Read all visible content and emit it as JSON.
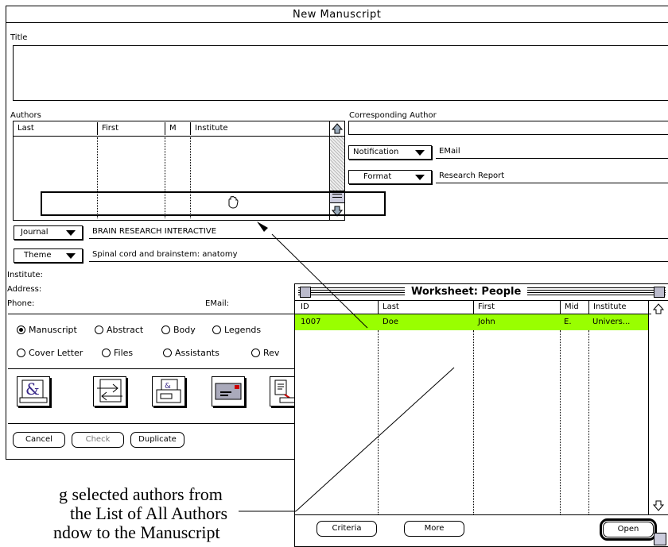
{
  "window": {
    "title": "New Manuscript"
  },
  "title_section": {
    "label": "Title",
    "value": ""
  },
  "authors": {
    "label": "Authors",
    "columns": [
      "Last",
      "First",
      "M",
      "Institute"
    ]
  },
  "corresponding": {
    "label": "Corresponding Author",
    "value": "",
    "notification": {
      "label": "Notification",
      "value": "EMail"
    },
    "format": {
      "label": "Format",
      "value": "Research Report"
    }
  },
  "journal": {
    "label": "Journal",
    "value": "BRAIN RESEARCH INTERACTIVE"
  },
  "theme": {
    "label": "Theme",
    "value": "Spinal cord and brainstem: anatomy"
  },
  "contact": {
    "institute_label": "Institute:",
    "address_label": "Address:",
    "phone_label": "Phone:",
    "email_label": "EMail:"
  },
  "radios": {
    "row1": [
      "Manuscript",
      "Abstract",
      "Body",
      "Legends"
    ],
    "row2": [
      "Cover Letter",
      "Files",
      "Assistants",
      "Rev"
    ],
    "selected": "Manuscript"
  },
  "buttons": {
    "cancel": "Cancel",
    "check": "Check",
    "duplicate": "Duplicate"
  },
  "worksheet": {
    "title": "Worksheet: People",
    "columns": [
      "ID",
      "Last",
      "First",
      "Mid",
      "Institute"
    ],
    "rows": [
      {
        "id": "1007",
        "last": "Doe",
        "first": "John",
        "mid": "E.",
        "institute": "Univers..."
      }
    ],
    "highlight_color": "#99ff00",
    "buttons": {
      "criteria": "Criteria",
      "more": "More",
      "open": "Open"
    }
  },
  "caption": {
    "line1": "g selected authors from",
    "line2": "the List of All Authors",
    "line3": "ndow to the Manuscript"
  }
}
